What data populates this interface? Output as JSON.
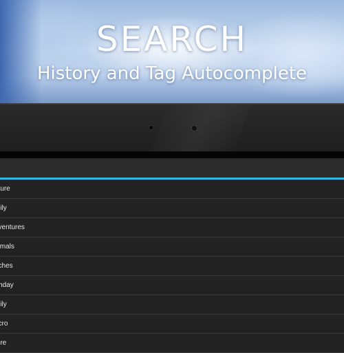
{
  "promo": {
    "title": "SEARCH",
    "subtitle": "History and Tag Autocomplete"
  },
  "search": {
    "query": "",
    "underline_color": "#33b5e5"
  },
  "suggestions": [
    {
      "label": "ature"
    },
    {
      "label": "mily"
    },
    {
      "label": "dventures"
    },
    {
      "label": "nimals"
    },
    {
      "label": "aches"
    },
    {
      "label": "rthday"
    },
    {
      "label": "mily"
    },
    {
      "label": "acro"
    },
    {
      "label": "ture"
    }
  ]
}
